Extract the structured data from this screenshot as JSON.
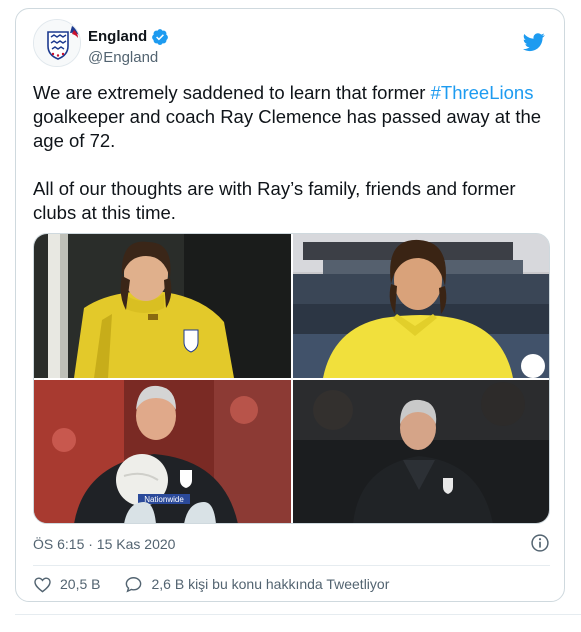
{
  "account": {
    "display_name": "England",
    "handle": "@England",
    "verified": true
  },
  "tweet": {
    "text_before_hashtag": "We are extremely saddened to learn that former ",
    "hashtag": "#ThreeLions",
    "text_after_hashtag": " goalkeeper and coach Ray Clemence has passed away at the age of 72.",
    "second_paragraph": "All of our thoughts are with Ray’s family, friends and former clubs at this time."
  },
  "media": {
    "photo_count": 4,
    "photo_1": {
      "sponsor_text": ""
    },
    "photo_4": {
      "sponsor_text": ""
    },
    "photo_3": {
      "sponsor_text": "Nationwide"
    }
  },
  "meta": {
    "timestamp": "ÖS 6:15 · 15 Kas 2020"
  },
  "actions": {
    "likes": "20,5 B",
    "discussion": "2,6 B kişi bu konu hakkında Tweetliyor"
  },
  "colors": {
    "accent": "#1d9bf0",
    "text": "#0f1419",
    "secondary": "#536471",
    "border": "#cfd9de"
  },
  "icons": [
    "england-crest-icon",
    "verified-badge-icon",
    "twitter-bird-icon",
    "info-icon",
    "heart-icon",
    "speech-bubble-icon"
  ]
}
